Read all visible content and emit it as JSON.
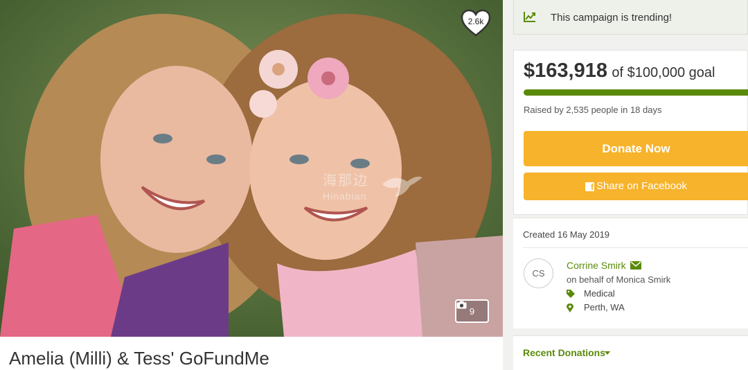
{
  "header_badges": {
    "hearts_count": "2.6k",
    "photo_count": "9"
  },
  "watermark": {
    "cn": "海那边",
    "en": "Hinabian"
  },
  "campaign": {
    "title": "Amelia (Milli) & Tess' GoFundMe"
  },
  "trending": {
    "label": "This campaign is trending!",
    "icon": "trend-chart-icon"
  },
  "fundraising": {
    "raised": "$163,918",
    "goal_text": "of $100,000 goal",
    "progress_fraction": 1.0,
    "raised_by": "Raised by 2,535 people in 18 days",
    "donate_label": "Donate Now",
    "share_label": "Share on Facebook"
  },
  "info": {
    "created": "Created 16 May 2019",
    "avatar_initials": "CS",
    "organizer_name": "Corrine Smirk",
    "behalf": "on behalf of Monica Smirk",
    "category": "Medical",
    "location": "Perth, WA"
  },
  "donations": {
    "label": "Recent Donations"
  },
  "colors": {
    "accent_green": "#5a8a0a",
    "button_yellow": "#f7b32b",
    "trending_bg": "#eef0ea"
  }
}
